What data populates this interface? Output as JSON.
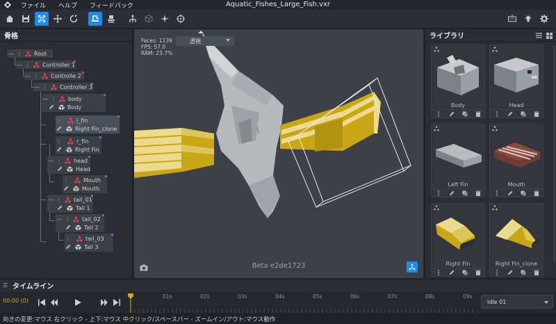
{
  "window": {
    "title": "Aquatic_Fishes_Large_Fish.vxr"
  },
  "menu": [
    "ファイル",
    "ヘルプ",
    "フィードバック"
  ],
  "colors": {
    "accent": "#1a8cf0",
    "bone": "#e0434a",
    "marker": "#a44ad8",
    "fin_yellow": "#c9a616",
    "fin_light": "#ecdb8f",
    "timecode": "#e0a32a"
  },
  "bones_panel": {
    "title": "骨格",
    "nodes": [
      {
        "label": "Root"
      },
      {
        "label": "Controller 1"
      },
      {
        "label": "Controlle 2"
      },
      {
        "label": "Controller 3"
      },
      {
        "label": "body",
        "mesh": "Body"
      },
      {
        "label": "l_fin",
        "mesh": "Right Fin_clone"
      },
      {
        "label": "r_fin",
        "mesh": "Right Fin"
      },
      {
        "label": "head",
        "mesh": "Head"
      },
      {
        "label": "Mouth",
        "mesh": "Mouth"
      },
      {
        "label": "tail_01",
        "mesh": "Tail 1"
      },
      {
        "label": "tail_02",
        "mesh": "Tail 2"
      },
      {
        "label": "tail_03",
        "mesh": "Tail 3"
      }
    ]
  },
  "viewport": {
    "faces": "Faces: 1139",
    "fps": "FPS: 57.0",
    "ram": "RAM: 23.7%",
    "projection": "透視",
    "version": "Beta e2de1723"
  },
  "library": {
    "title": "ライブラリ",
    "items": [
      {
        "name": "Body"
      },
      {
        "name": "Head"
      },
      {
        "name": "Left Fin"
      },
      {
        "name": "Mouth"
      },
      {
        "name": "Right Fin"
      },
      {
        "name": "Right Fin_clone"
      }
    ]
  },
  "timeline": {
    "title": "タイムライン",
    "timecode": "00:00 (0)",
    "ticks": [
      "01s",
      "02s",
      "03s",
      "04s",
      "05s",
      "06s",
      "07s",
      "08s",
      "09s"
    ],
    "animation": "Idle 01"
  },
  "status": {
    "hint": "向きの変更:マウス 右クリック - 上下:マウス 中クリック/スペースバー - ズームイン/アウト:マウス動作"
  }
}
